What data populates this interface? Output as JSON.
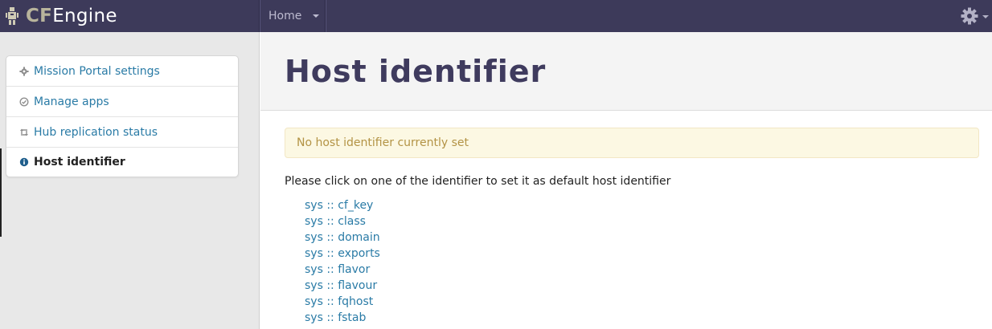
{
  "brand": {
    "prefix": "CF",
    "suffix": "Engine"
  },
  "topnav": {
    "home_label": "Home"
  },
  "sidebar": {
    "items": [
      {
        "label": "Mission Portal settings",
        "icon": "gear-icon"
      },
      {
        "label": "Manage apps",
        "icon": "check-circle-icon"
      },
      {
        "label": "Hub replication status",
        "icon": "sync-icon"
      },
      {
        "label": "Host identifier",
        "icon": "info-icon",
        "active": true
      }
    ]
  },
  "main": {
    "title": "Host identifier",
    "alert": "No host identifier currently set",
    "instructions": "Please click on one of the identifier to set it as default host identifier",
    "identifiers": [
      "sys :: cf_key",
      "sys :: class",
      "sys :: domain",
      "sys :: exports",
      "sys :: flavor",
      "sys :: flavour",
      "sys :: fqhost",
      "sys :: fstab"
    ]
  },
  "colors": {
    "topbar": "#3d3a5a",
    "link": "#2a7ba6",
    "title": "#3f3b5e",
    "alert_bg": "#fcf8e3",
    "alert_text": "#b39345"
  }
}
